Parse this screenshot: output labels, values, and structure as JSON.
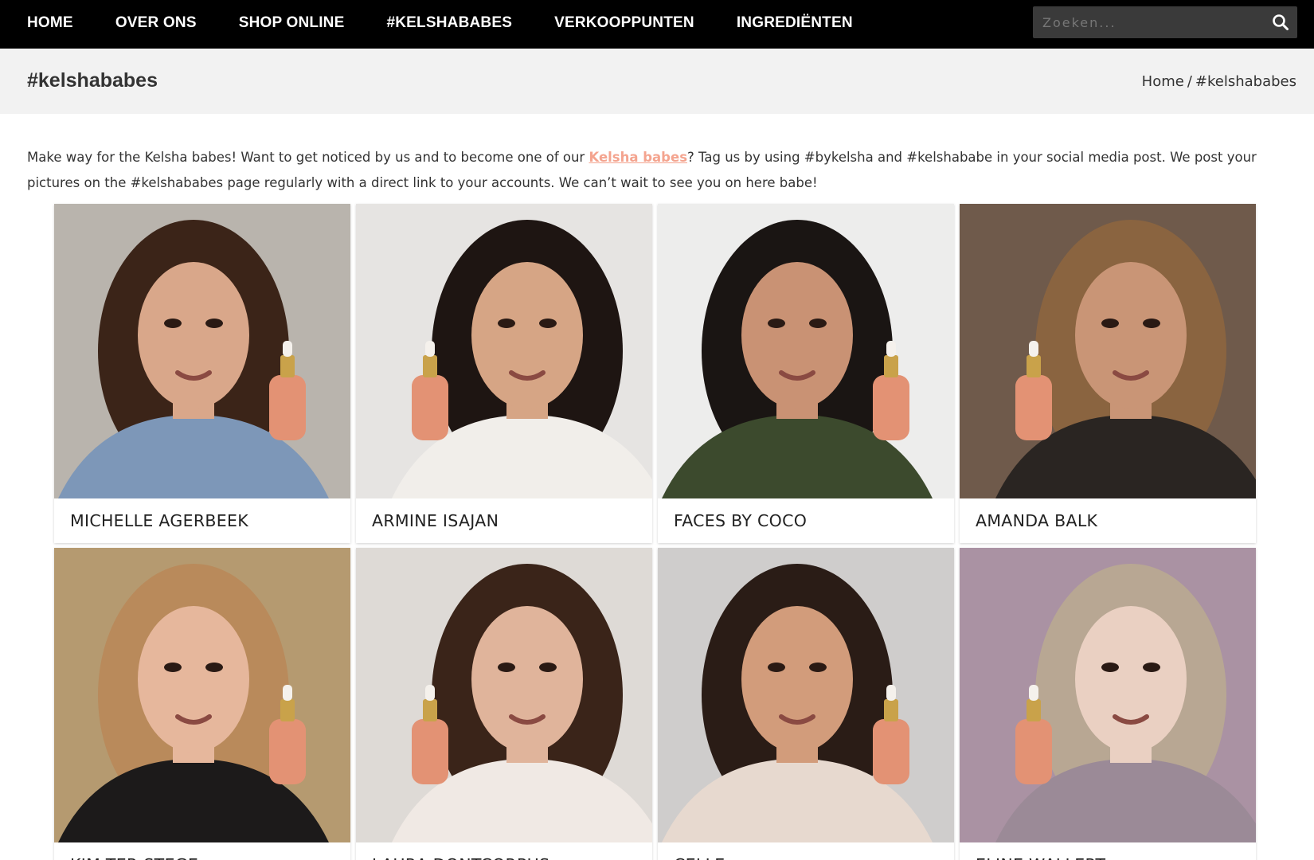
{
  "nav": {
    "items": [
      "HOME",
      "OVER ONS",
      "SHOP ONLINE",
      "#KELSHABABES",
      "VERKOOPPUNTEN",
      "INGREDIËNTEN"
    ],
    "search_placeholder": "Zoeken..."
  },
  "page": {
    "title": "#kelshababes",
    "breadcrumb_home": "Home",
    "breadcrumb_sep": "/",
    "breadcrumb_current": "#kelshababes"
  },
  "intro": {
    "part1": "Make way for the Kelsha babes! Want to get noticed by us and to become one of our ",
    "highlight": "Kelsha babes",
    "part2": "? Tag us by using #bykelsha and #kelshababe in your social media post. We post your pictures on the #kelshababes page regularly with a direct link to your accounts. We can’t wait to see you on here babe!"
  },
  "colors": {
    "accent": "#f4a48f",
    "nav_bg": "#000000",
    "titlebar_bg": "#f2f2f2"
  },
  "babes": [
    {
      "name": "MICHELLE AGERBEEK",
      "bg": "#b9b4ad",
      "hair": "#3b2418",
      "skin": "#d9a78a",
      "cloth": "#7d97b8"
    },
    {
      "name": "ARMINE ISAJAN",
      "bg": "#e6e4e2",
      "hair": "#1e1512",
      "skin": "#d6a585",
      "cloth": "#f1eeea"
    },
    {
      "name": "FACES BY COCO",
      "bg": "#ededec",
      "hair": "#1a1513",
      "skin": "#c99274",
      "cloth": "#3c4a2d"
    },
    {
      "name": "AMANDA BALK",
      "bg": "#6f5a4b",
      "hair": "#8a6440",
      "skin": "#c99576",
      "cloth": "#2a2522"
    },
    {
      "name": "KIM TER STEGE",
      "bg": "#b59a70",
      "hair": "#b98a5b",
      "skin": "#e6b79c",
      "cloth": "#1c1a1a"
    },
    {
      "name": "LAURA DONTCORPUS",
      "bg": "#dedad6",
      "hair": "#3a2419",
      "skin": "#e0b49b",
      "cloth": "#f0e9e4"
    },
    {
      "name": "CELLE",
      "bg": "#cfcdcc",
      "hair": "#2a1c16",
      "skin": "#d29c7b",
      "cloth": "#e7d9cf"
    },
    {
      "name": "ELINE WALLERT",
      "bg": "#aa92a3",
      "hair": "#b8a793",
      "skin": "#ead0c2",
      "cloth": "#9b8a97"
    }
  ]
}
